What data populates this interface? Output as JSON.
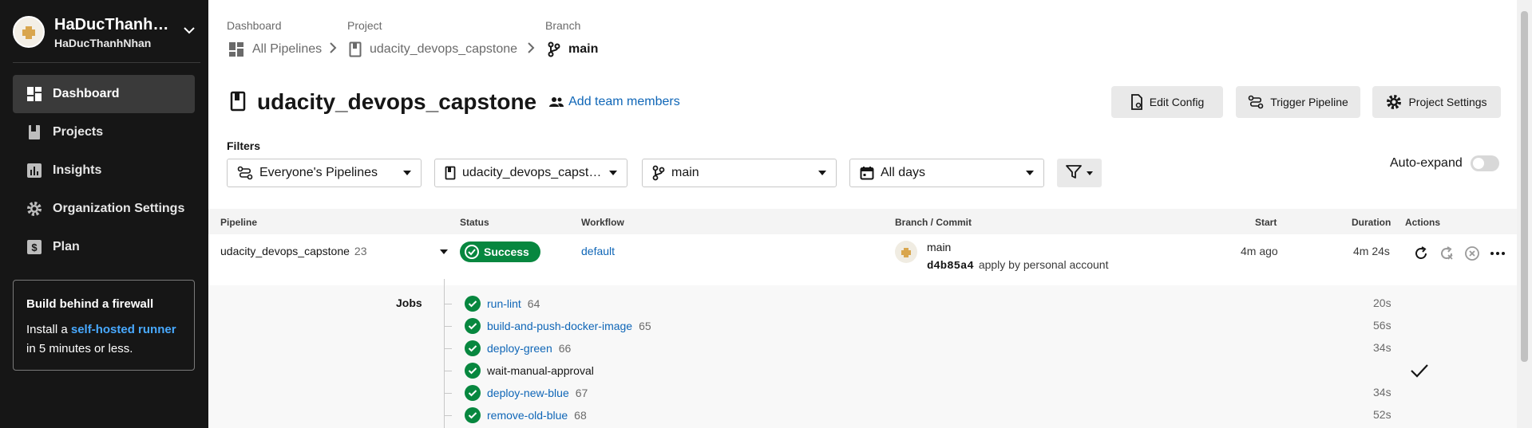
{
  "org": {
    "name": "HaDucThanhN...",
    "username": "HaDucThanhNhan"
  },
  "nav": [
    {
      "label": "Dashboard",
      "icon": "dashboard-icon"
    },
    {
      "label": "Projects",
      "icon": "book-icon"
    },
    {
      "label": "Insights",
      "icon": "chart-icon"
    },
    {
      "label": "Organization Settings",
      "icon": "gear-icon"
    },
    {
      "label": "Plan",
      "icon": "dollar-icon"
    }
  ],
  "promo": {
    "title": "Build behind a firewall",
    "text_before": "Install a ",
    "link": "self-hosted runner",
    "text_after": "in 5 minutes or less."
  },
  "breadcrumbs": {
    "dashboard_label": "Dashboard",
    "dashboard_value": "All Pipelines",
    "project_label": "Project",
    "project_value": "udacity_devops_capstone",
    "branch_label": "Branch",
    "branch_value": "main"
  },
  "header": {
    "title": "udacity_devops_capstone",
    "add_team": "Add team members",
    "edit_config": "Edit Config",
    "trigger_pipeline": "Trigger Pipeline",
    "project_settings": "Project Settings"
  },
  "filters": {
    "label": "Filters",
    "pipelines": "Everyone's Pipelines",
    "project": "udacity_devops_capstone",
    "branch": "main",
    "days": "All days",
    "auto_expand": "Auto-expand",
    "auto_expand_on": false
  },
  "table": {
    "headers": {
      "pipeline": "Pipeline",
      "status": "Status",
      "workflow": "Workflow",
      "branch_commit": "Branch / Commit",
      "start": "Start",
      "duration": "Duration",
      "actions": "Actions"
    },
    "row": {
      "project": "udacity_devops_capstone",
      "number": "23",
      "status": "Success",
      "workflow": "default",
      "branch": "main",
      "commit_hash": "d4b85a4",
      "commit_message": "apply by personal account",
      "start": "4m ago",
      "duration": "4m 24s"
    }
  },
  "jobs": {
    "label": "Jobs",
    "items": [
      {
        "name": "run-lint",
        "number": "64",
        "duration": "20s"
      },
      {
        "name": "build-and-push-docker-image",
        "number": "65",
        "duration": "56s"
      },
      {
        "name": "deploy-green",
        "number": "66",
        "duration": "34s"
      },
      {
        "name": "wait-manual-approval",
        "number": "",
        "duration": ""
      },
      {
        "name": "deploy-new-blue",
        "number": "67",
        "duration": "34s"
      },
      {
        "name": "remove-old-blue",
        "number": "68",
        "duration": "52s"
      }
    ]
  },
  "colors": {
    "success": "#07873f",
    "link": "#0f66b7",
    "sidebar": "#161616",
    "promo_link": "#48a9ff"
  }
}
